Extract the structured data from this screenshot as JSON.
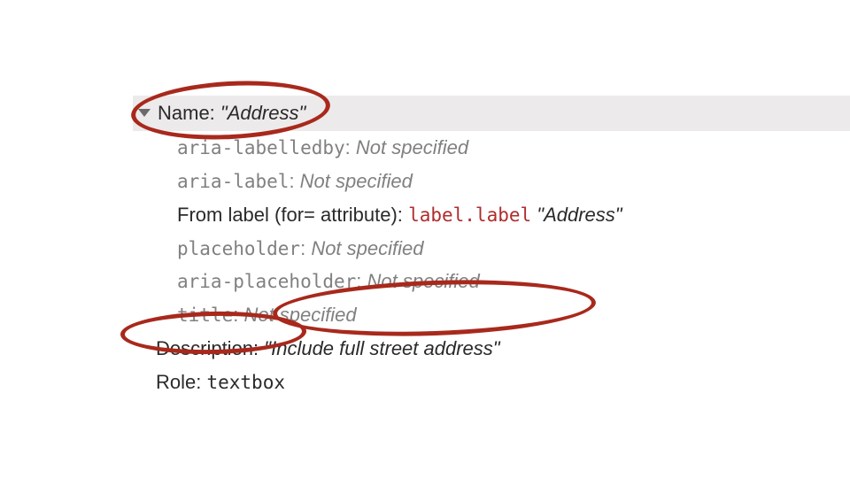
{
  "header": {
    "name_label": "Name:",
    "name_value": "Address"
  },
  "computed": [
    {
      "attr": "aria-labelledby",
      "value": "Not specified",
      "dim": true
    },
    {
      "attr": "aria-label",
      "value": "Not specified",
      "dim": true
    },
    {
      "from_label_prefix": "From label (for= attribute):",
      "selector_tag": "label",
      "selector_class": ".label",
      "quoted": "Address"
    },
    {
      "attr": "placeholder",
      "value": "Not specified",
      "dim": true
    },
    {
      "attr": "aria-placeholder",
      "value": "Not specified",
      "dim": true
    },
    {
      "attr": "title",
      "value": "Not specified",
      "dim": true
    }
  ],
  "summary": {
    "description_label": "Description:",
    "description_value": "Include full street address",
    "role_label": "Role:",
    "role_value": "textbox"
  }
}
